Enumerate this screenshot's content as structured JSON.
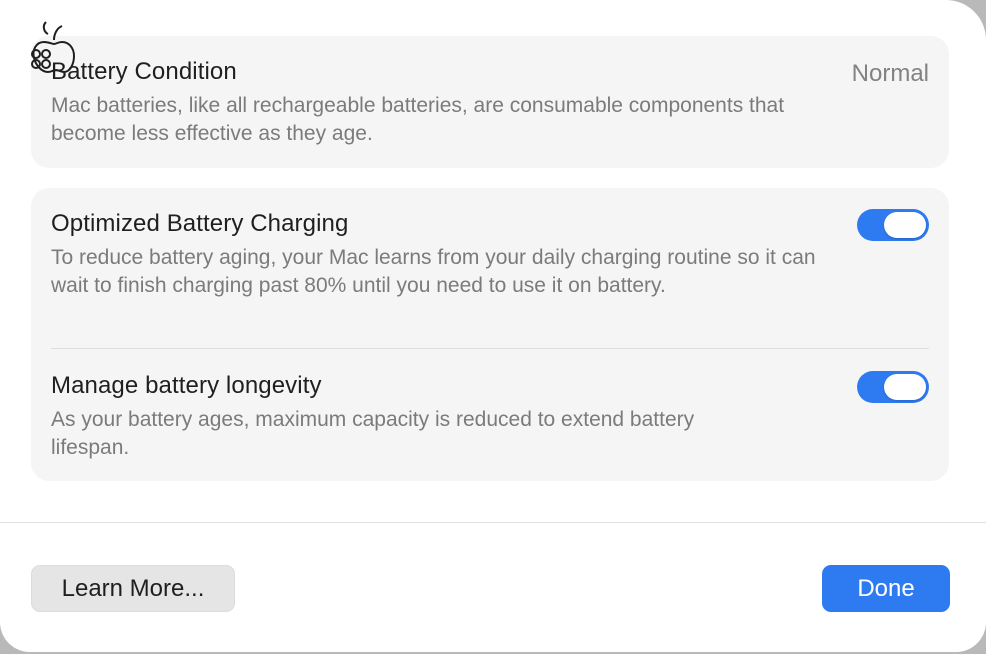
{
  "battery_condition": {
    "title": "Battery Condition",
    "value": "Normal",
    "description": "Mac batteries, like all rechargeable batteries, are consumable components that become less effective as they age."
  },
  "optimized_charging": {
    "title": "Optimized Battery Charging",
    "description": "To reduce battery aging, your Mac learns from your daily charging routine so it can wait to finish charging past 80% until you need to use it on battery.",
    "enabled": true
  },
  "manage_longevity": {
    "title": "Manage battery longevity",
    "description": "As your battery ages, maximum capacity is reduced to extend battery lifespan.",
    "enabled": true
  },
  "footer": {
    "learn_more_label": "Learn More...",
    "done_label": "Done"
  },
  "colors": {
    "accent": "#2e7bf1",
    "card_bg": "#f5f5f5"
  },
  "icons": {
    "overlay": "apple-command-icon"
  }
}
